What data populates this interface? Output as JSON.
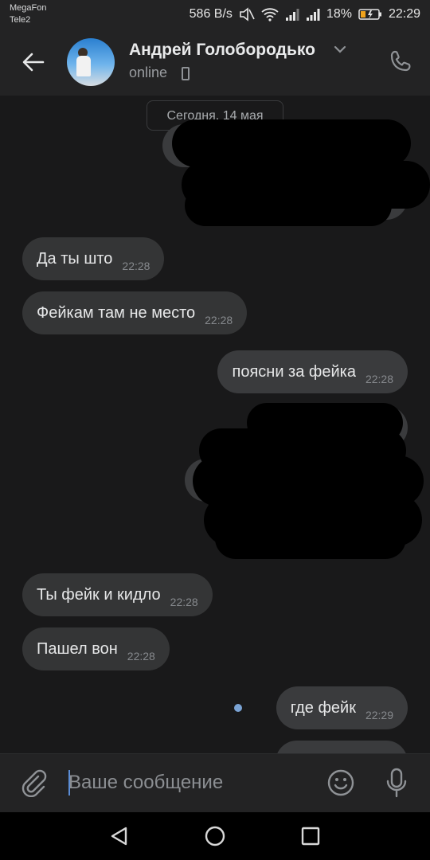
{
  "status_bar": {
    "carrier_1": "MegaFon",
    "carrier_2": "Tele2",
    "network_speed": "586 B/s",
    "battery": "18%",
    "time": "22:29"
  },
  "header": {
    "contact_name": "Андрей Голобородько",
    "status": "online",
    "icons": {
      "back": "arrow-left-icon",
      "call": "phone-icon",
      "chevron": "chevron-down-icon",
      "device": "mobile-phone-icon"
    }
  },
  "chat": {
    "date_label": "Сегодня, 14 мая",
    "messages": [
      {
        "direction": "in",
        "text": "Да ты што",
        "time": "22:28"
      },
      {
        "direction": "in",
        "text": "Фейкам там не место",
        "time": "22:28"
      },
      {
        "direction": "out",
        "text": "поясни за фейка",
        "time": "22:28"
      },
      {
        "direction": "in",
        "text": "Ты фейк и кидло",
        "time": "22:28"
      },
      {
        "direction": "in",
        "text": "Пашел вон",
        "time": "22:28"
      },
      {
        "direction": "out",
        "text": "где фейк",
        "time": "22:29",
        "unread": true
      }
    ]
  },
  "composer": {
    "placeholder": "Ваше сообщение",
    "icons": {
      "attach": "paperclip-icon",
      "emoji": "smiley-icon",
      "mic": "microphone-icon"
    }
  },
  "nav_bar": {
    "icons": [
      "triangle-back-icon",
      "circle-home-icon",
      "square-recents-icon"
    ]
  },
  "colors": {
    "background": "#19191a",
    "bar": "#232324",
    "bubble": "#343536",
    "accent": "#5b8dd6"
  }
}
